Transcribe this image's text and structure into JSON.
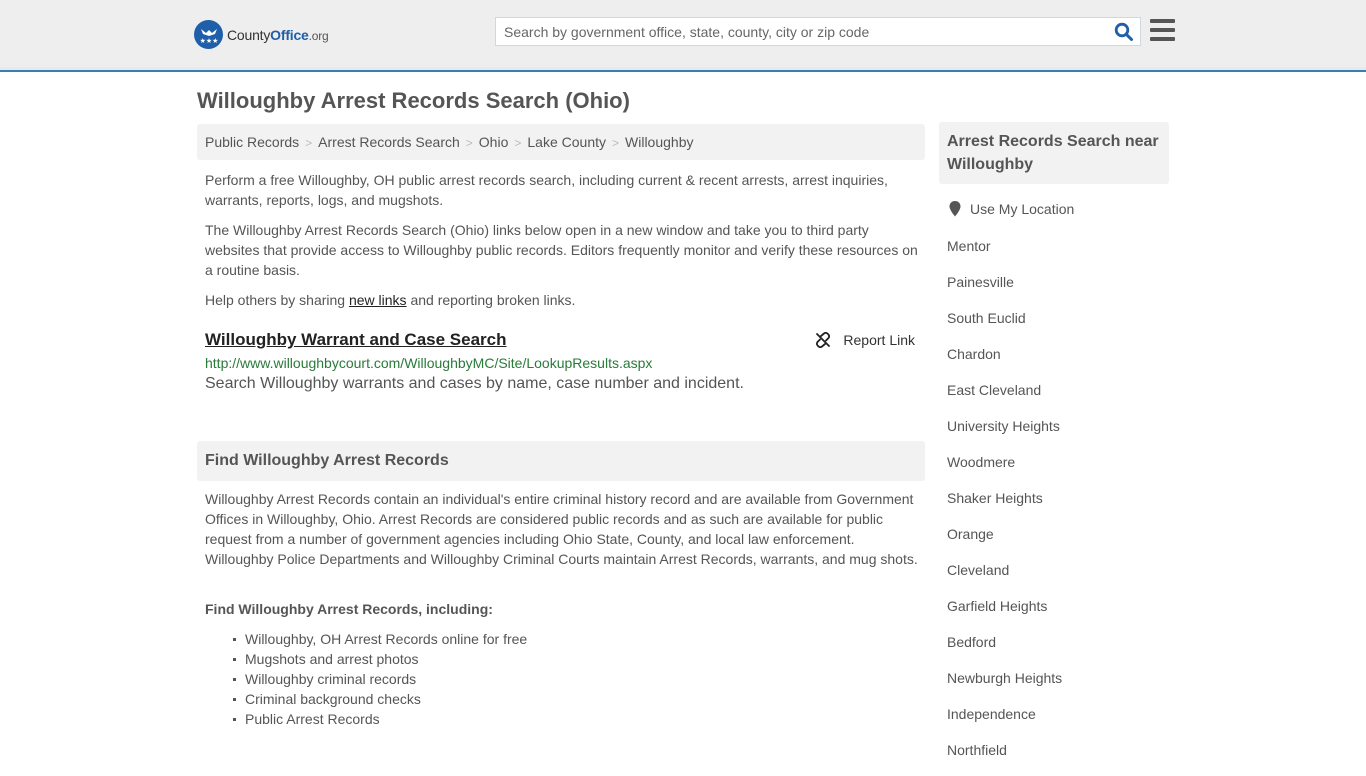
{
  "header": {
    "logo": {
      "name_part1": "County",
      "name_part2": "Office",
      "suffix": ".org"
    },
    "search": {
      "placeholder": "Search by government office, state, county, city or zip code",
      "value": ""
    },
    "colors": {
      "brand_blue": "#1f5ea8",
      "header_border": "#3a7db0",
      "header_bg": "#eeeeee"
    }
  },
  "page": {
    "title": "Willoughby Arrest Records Search (Ohio)"
  },
  "breadcrumb": [
    "Public Records",
    "Arrest Records Search",
    "Ohio",
    "Lake County",
    "Willoughby"
  ],
  "intro": {
    "p1": "Perform a free Willoughby, OH public arrest records search, including current & recent arrests, arrest inquiries, warrants, reports, logs, and mugshots.",
    "p2": "The Willoughby Arrest Records Search (Ohio) links below open in a new window and take you to third party websites that provide access to Willoughby public records. Editors frequently monitor and verify these resources on a routine basis.",
    "p3_before": "Help others by sharing ",
    "p3_link": "new links",
    "p3_after": " and reporting broken links."
  },
  "resource": {
    "title": "Willoughby Warrant and Case Search",
    "report_label": "Report Link",
    "url": "http://www.willoughbycourt.com/WilloughbyMC/Site/LookupResults.aspx",
    "description": "Search Willoughby warrants and cases by name, case number and incident.",
    "url_color": "#2a7a3a"
  },
  "find_section": {
    "heading": "Find Willoughby Arrest Records",
    "body": "Willoughby Arrest Records contain an individual's entire criminal history record and are available from Government Offices in Willoughby, Ohio. Arrest Records are considered public records and as such are available for public request from a number of government agencies including Ohio State, County, and local law enforcement. Willoughby Police Departments and Willoughby Criminal Courts maintain Arrest Records, warrants, and mug shots.",
    "subheading": "Find Willoughby Arrest Records, including:",
    "items": [
      "Willoughby, OH Arrest Records online for free",
      "Mugshots and arrest photos",
      "Willoughby criminal records",
      "Criminal background checks",
      "Public Arrest Records"
    ]
  },
  "sidebar": {
    "heading": "Arrest Records Search near Willoughby",
    "use_location": "Use My Location",
    "nearby": [
      "Mentor",
      "Painesville",
      "South Euclid",
      "Chardon",
      "East Cleveland",
      "University Heights",
      "Woodmere",
      "Shaker Heights",
      "Orange",
      "Cleveland",
      "Garfield Heights",
      "Bedford",
      "Newburgh Heights",
      "Independence",
      "Northfield"
    ]
  }
}
